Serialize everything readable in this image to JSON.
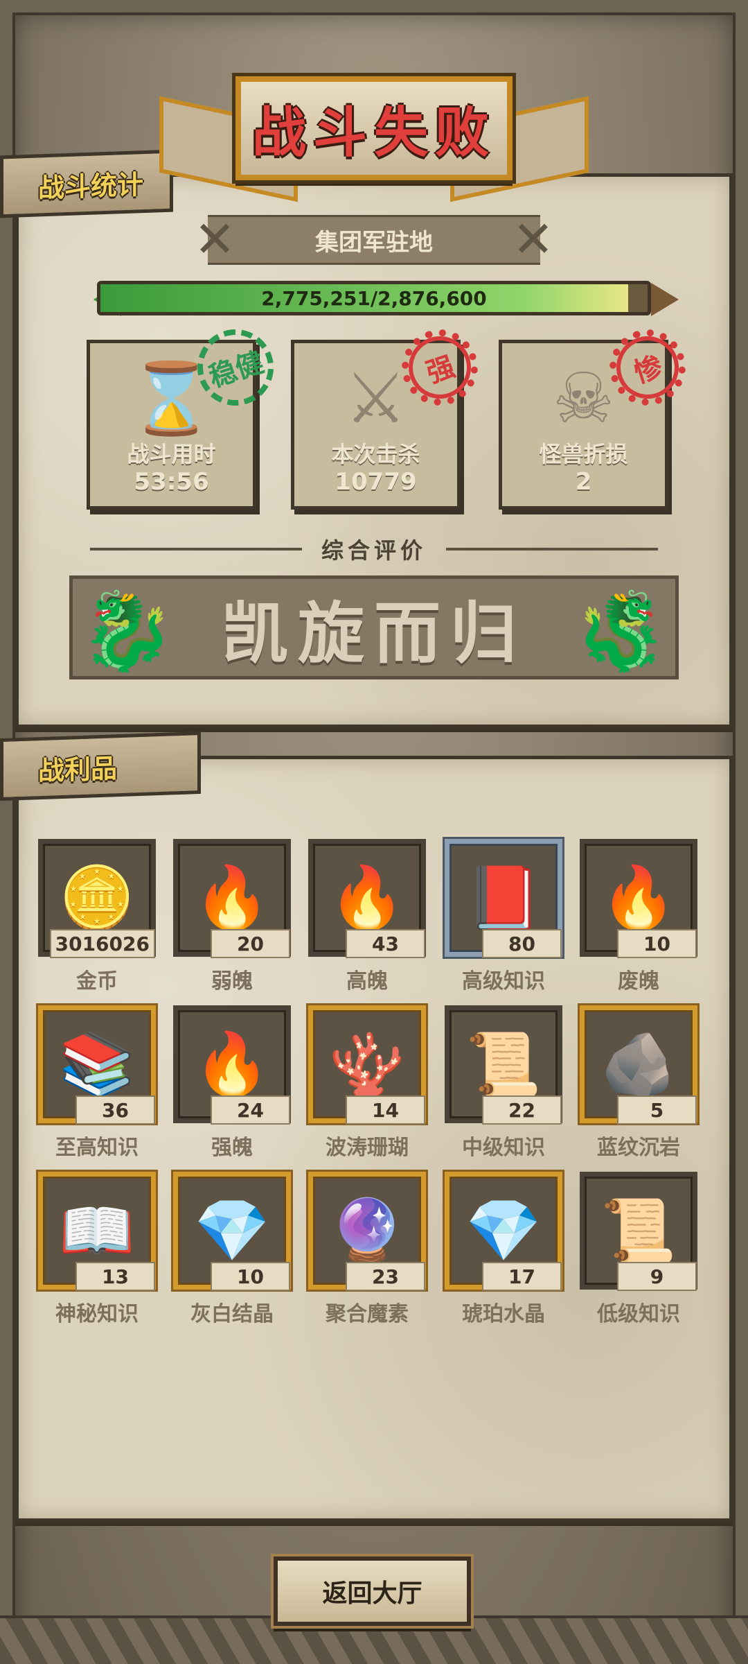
{
  "title": "战斗失败",
  "stats_section": {
    "tab_label": "战斗统计",
    "location": "集团军驻地",
    "progress_text": "2,775,251/2,876,600",
    "progress_fraction": 0.965,
    "cards": [
      {
        "icon": "hourglass-icon",
        "glyph": "⌛",
        "label": "战斗用时",
        "value": "53:56",
        "stamp": "稳健",
        "stamp_color": "#2d9a52"
      },
      {
        "icon": "crossed-swords-icon",
        "glyph": "⚔",
        "label": "本次击杀",
        "value": "10779",
        "stamp": "强",
        "stamp_color": "#d63a3a"
      },
      {
        "icon": "monster-skull-icon",
        "glyph": "☠",
        "label": "怪兽折损",
        "value": "2",
        "stamp": "惨",
        "stamp_color": "#d63a3a"
      }
    ],
    "rating_label": "综合评价",
    "rating_value": "凯旋而归"
  },
  "loot_section": {
    "tab_label": "战利品",
    "items": [
      {
        "name": "金币",
        "count": "3016026",
        "icon": "gold-coin-icon",
        "glyph": "🪙",
        "frame": "plain"
      },
      {
        "name": "弱魄",
        "count": "20",
        "icon": "small-flame-icon",
        "glyph": "🔥",
        "frame": "plain"
      },
      {
        "name": "高魄",
        "count": "43",
        "icon": "large-flame-icon",
        "glyph": "🔥",
        "frame": "plain"
      },
      {
        "name": "高级知识",
        "count": "80",
        "icon": "bound-book-icon",
        "glyph": "📕",
        "frame": "steel"
      },
      {
        "name": "废魄",
        "count": "10",
        "icon": "faint-flame-icon",
        "glyph": "🔥",
        "frame": "plain"
      },
      {
        "name": "至高知识",
        "count": "36",
        "icon": "purple-tome-icon",
        "glyph": "📚",
        "frame": "gold"
      },
      {
        "name": "强魄",
        "count": "24",
        "icon": "strong-flame-icon",
        "glyph": "🔥",
        "frame": "plain"
      },
      {
        "name": "波涛珊瑚",
        "count": "14",
        "icon": "coral-icon",
        "glyph": "🪸",
        "frame": "gold"
      },
      {
        "name": "中级知识",
        "count": "22",
        "icon": "scroll-icon",
        "glyph": "📜",
        "frame": "plain"
      },
      {
        "name": "蓝纹沉岩",
        "count": "5",
        "icon": "blue-rock-icon",
        "glyph": "🪨",
        "frame": "gold"
      },
      {
        "name": "神秘知识",
        "count": "13",
        "icon": "ancient-tablet-icon",
        "glyph": "📖",
        "frame": "gold"
      },
      {
        "name": "灰白结晶",
        "count": "10",
        "icon": "gray-crystal-icon",
        "glyph": "💎",
        "frame": "gold"
      },
      {
        "name": "聚合魔素",
        "count": "23",
        "icon": "magic-orb-icon",
        "glyph": "🔮",
        "frame": "gold"
      },
      {
        "name": "琥珀水晶",
        "count": "17",
        "icon": "amber-crystal-icon",
        "glyph": "💎",
        "frame": "gold"
      },
      {
        "name": "低级知识",
        "count": "9",
        "icon": "rolled-scroll-icon",
        "glyph": "📜",
        "frame": "plain"
      }
    ]
  },
  "return_button_label": "返回大厅"
}
